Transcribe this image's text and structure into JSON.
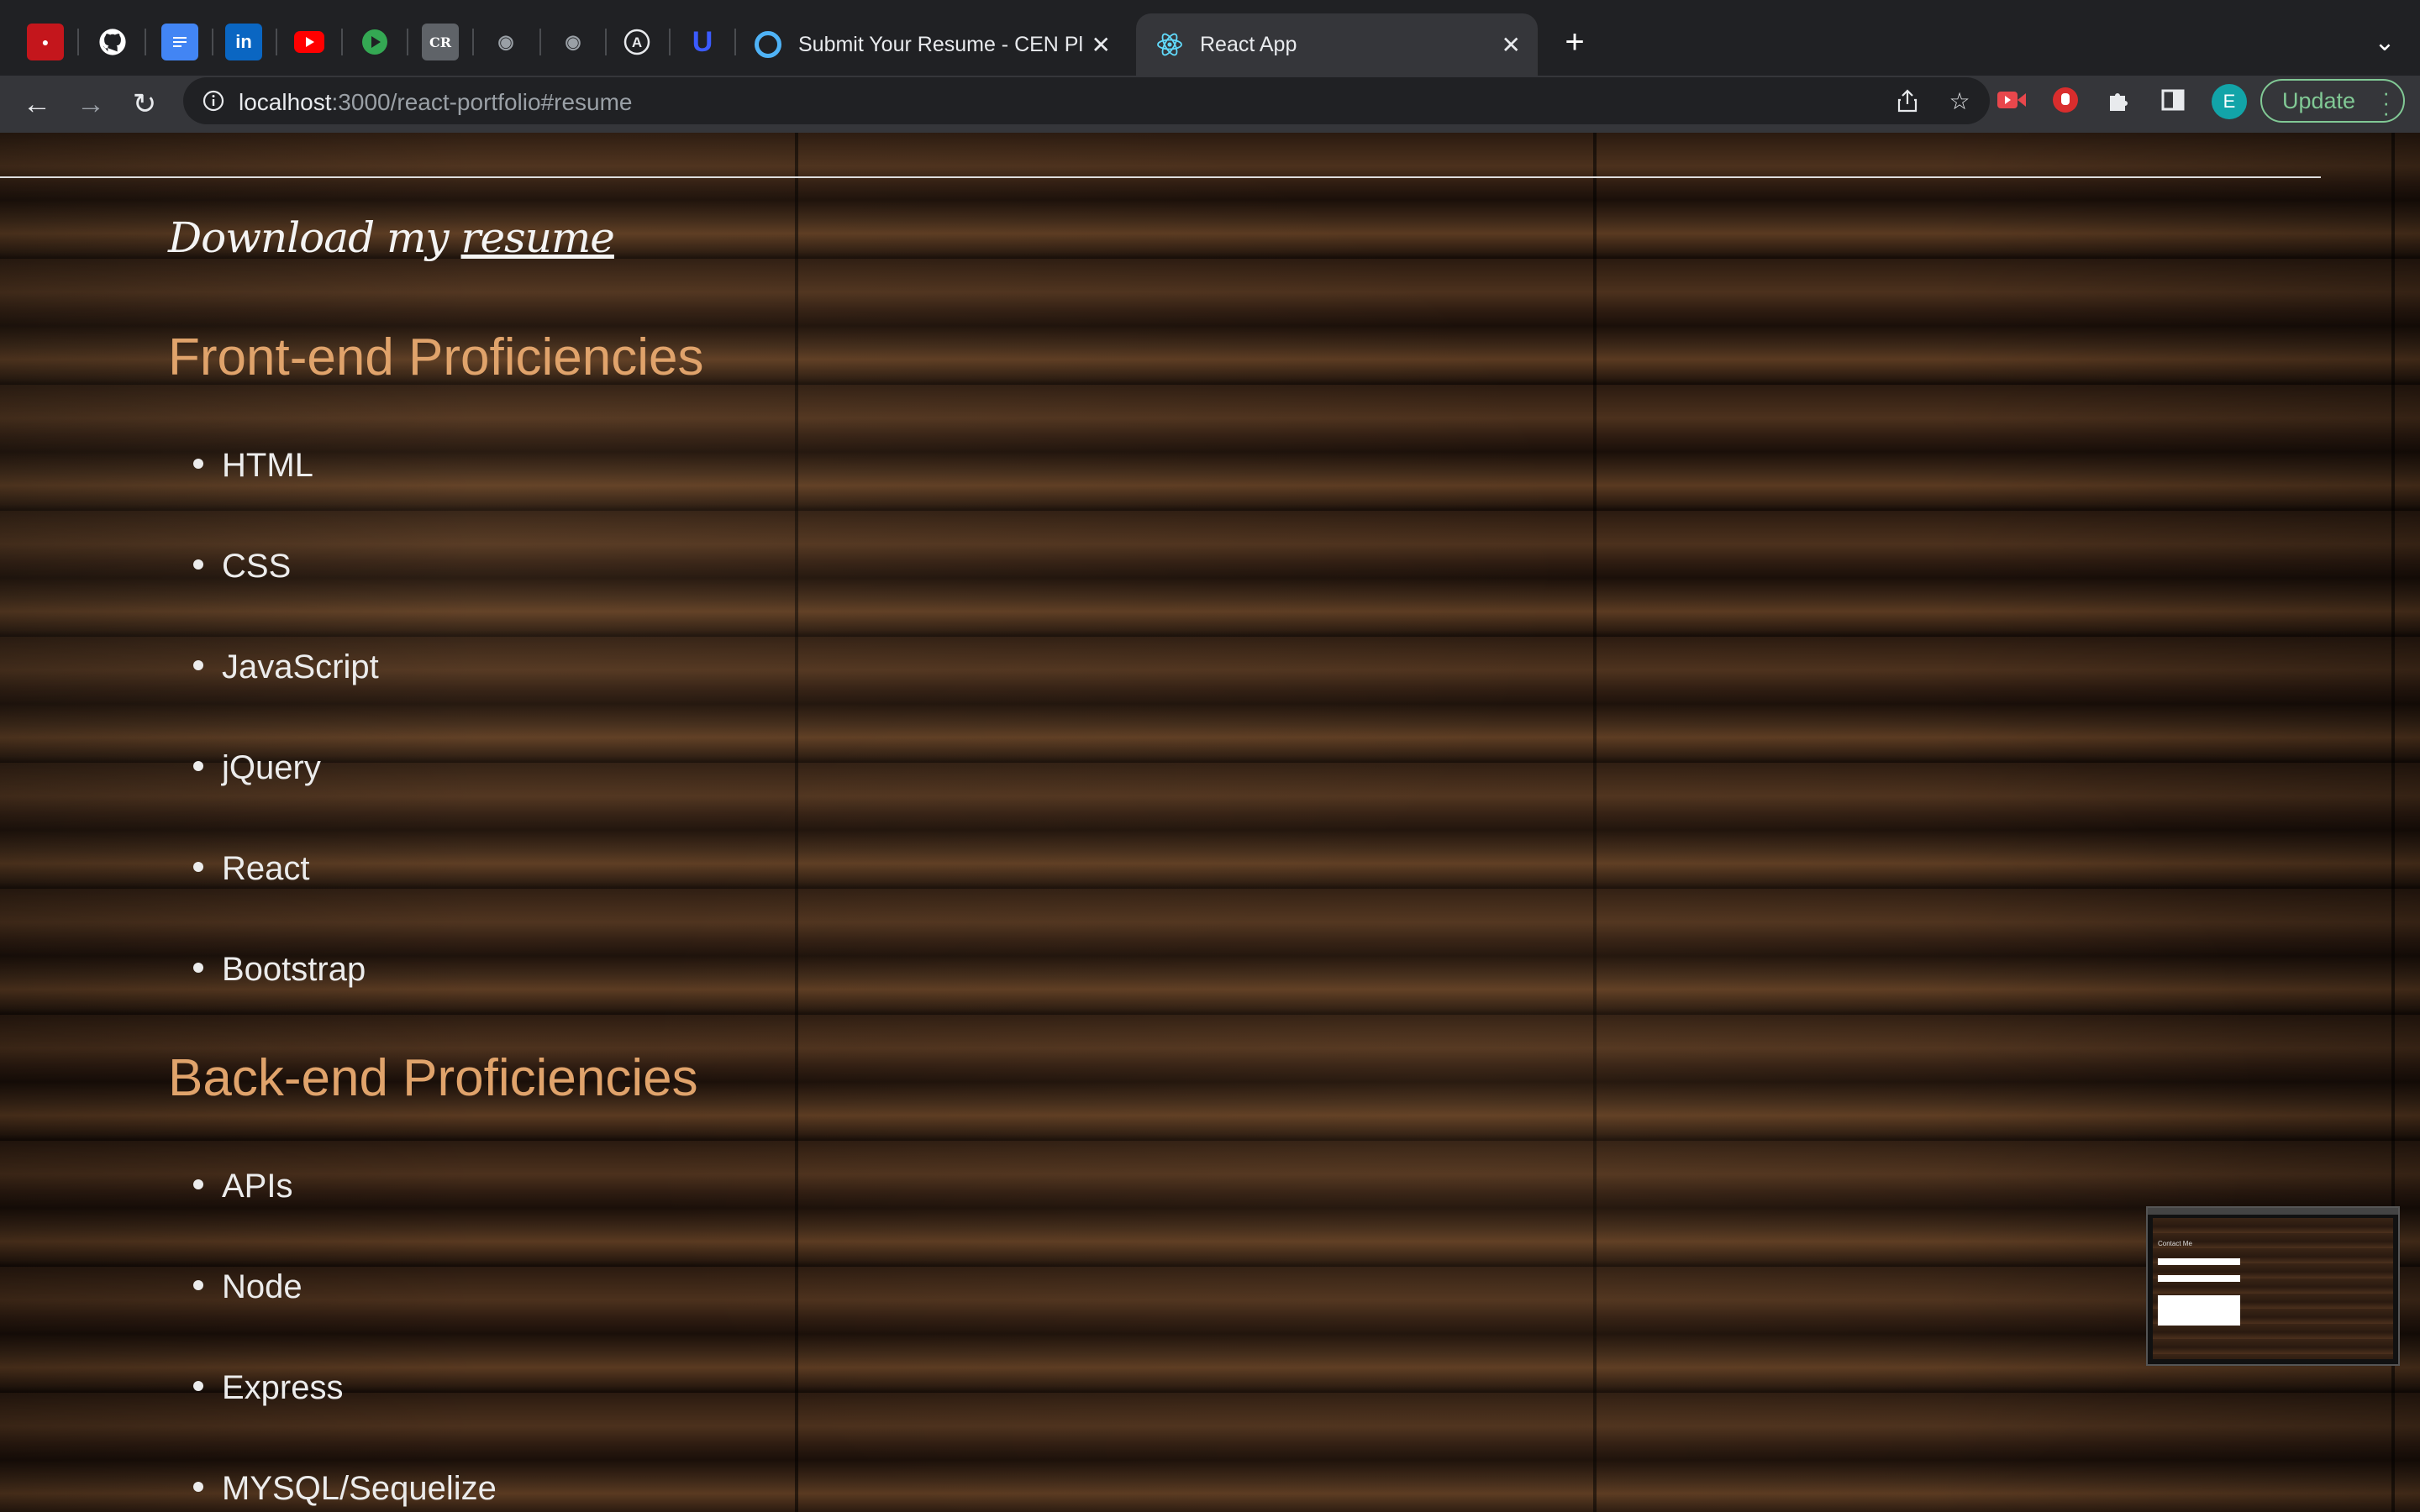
{
  "browser": {
    "pinned_tabs": [
      {
        "icon": "red-app-icon",
        "color": "#c4161c"
      },
      {
        "icon": "github-icon",
        "color": "#ffffff"
      },
      {
        "icon": "docs-icon",
        "color": "#4285f4"
      },
      {
        "icon": "linkedin-icon",
        "color": "#0a66c2"
      },
      {
        "icon": "youtube-icon",
        "color": "#ff0000"
      },
      {
        "icon": "play-icon",
        "color": "#34a853"
      },
      {
        "icon": "cr-icon",
        "color": "#5f6368"
      },
      {
        "icon": "eye-icon",
        "color": "#9aa0a6"
      },
      {
        "icon": "eye-icon-2",
        "color": "#9aa0a6"
      },
      {
        "icon": "a-circle-icon",
        "color": "#e8eaed"
      },
      {
        "icon": "u-icon",
        "color": "#3b5bff"
      }
    ],
    "tabs": [
      {
        "title": "Submit Your Resume - CEN Plu",
        "icon": "circle-icon",
        "active": false
      },
      {
        "title": "React App",
        "icon": "react-icon",
        "active": true
      }
    ],
    "new_tab_label": "+",
    "tab_menu_label": "⌄",
    "url_host": "localhost",
    "url_rest": ":3000/react-portfolio#resume",
    "profile_initial": "E",
    "update_label": "Update"
  },
  "page": {
    "download_prefix": "Download my ",
    "download_link": "resume",
    "sections": [
      {
        "title": "Front-end Proficiencies",
        "items": [
          "HTML",
          "CSS",
          "JavaScript",
          "jQuery",
          "React",
          "Bootstrap"
        ]
      },
      {
        "title": "Back-end Proficiencies",
        "items": [
          "APIs",
          "Node",
          "Express",
          "MYSQL/Sequelize"
        ]
      }
    ],
    "pip_label": "Contact Me"
  },
  "colors": {
    "accent": "#e0a36b",
    "text": "#ececec",
    "update_green": "#81c995"
  }
}
